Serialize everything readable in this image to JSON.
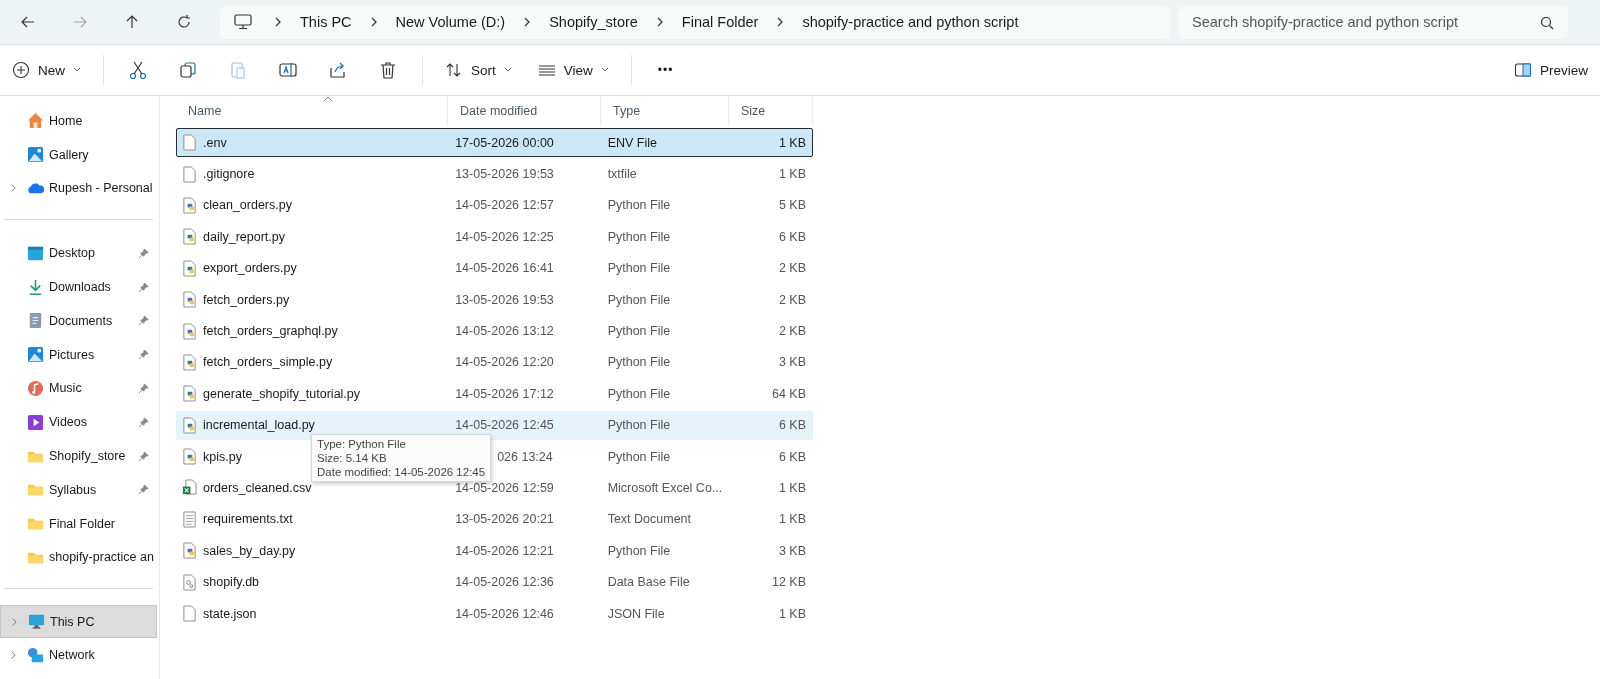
{
  "breadcrumb": [
    "This PC",
    "New Volume (D:)",
    "Shopify_store",
    "Final Folder",
    "shopify-practice and python script"
  ],
  "search": {
    "placeholder": "Search shopify-practice and python script"
  },
  "toolbar": {
    "new": "New",
    "sort": "Sort",
    "view": "View",
    "more": "•••",
    "preview": "Preview"
  },
  "sidebar": {
    "top": [
      {
        "label": "Home",
        "expandable": false
      },
      {
        "label": "Gallery",
        "expandable": false
      },
      {
        "label": "Rupesh - Personal",
        "expandable": true
      }
    ],
    "quick": [
      {
        "label": "Desktop",
        "pinned": true
      },
      {
        "label": "Downloads",
        "pinned": true
      },
      {
        "label": "Documents",
        "pinned": true
      },
      {
        "label": "Pictures",
        "pinned": true
      },
      {
        "label": "Music",
        "pinned": true
      },
      {
        "label": "Videos",
        "pinned": true
      },
      {
        "label": "Shopify_store",
        "pinned": true
      },
      {
        "label": "Syllabus",
        "pinned": true
      },
      {
        "label": "Final Folder",
        "pinned": false
      },
      {
        "label": "shopify-practice an",
        "pinned": false
      }
    ],
    "bottom": [
      {
        "label": "This PC",
        "selected": true
      },
      {
        "label": "Network",
        "selected": false
      }
    ]
  },
  "columns": [
    "Name",
    "Date modified",
    "Type",
    "Size"
  ],
  "files": [
    {
      "name": ".env",
      "date": "17-05-2026 00:00",
      "type": "ENV File",
      "size": "1 KB",
      "kind": "blank",
      "selected": true,
      "hovered": false
    },
    {
      "name": ".gitignore",
      "date": "13-05-2026 19:53",
      "type": "txtfile",
      "size": "1 KB",
      "kind": "blank",
      "selected": false,
      "hovered": false
    },
    {
      "name": "clean_orders.py",
      "date": "14-05-2026 12:57",
      "type": "Python File",
      "size": "5 KB",
      "kind": "python",
      "selected": false,
      "hovered": false
    },
    {
      "name": "daily_report.py",
      "date": "14-05-2026 12:25",
      "type": "Python File",
      "size": "6 KB",
      "kind": "python",
      "selected": false,
      "hovered": false
    },
    {
      "name": "export_orders.py",
      "date": "14-05-2026 16:41",
      "type": "Python File",
      "size": "2 KB",
      "kind": "python",
      "selected": false,
      "hovered": false
    },
    {
      "name": "fetch_orders.py",
      "date": "13-05-2026 19:53",
      "type": "Python File",
      "size": "2 KB",
      "kind": "python",
      "selected": false,
      "hovered": false
    },
    {
      "name": "fetch_orders_graphql.py",
      "date": "14-05-2026 13:12",
      "type": "Python File",
      "size": "2 KB",
      "kind": "python",
      "selected": false,
      "hovered": false
    },
    {
      "name": "fetch_orders_simple.py",
      "date": "14-05-2026 12:20",
      "type": "Python File",
      "size": "3 KB",
      "kind": "python",
      "selected": false,
      "hovered": false
    },
    {
      "name": "generate_shopify_tutorial.py",
      "date": "14-05-2026 17:12",
      "type": "Python File",
      "size": "64 KB",
      "kind": "python",
      "selected": false,
      "hovered": false
    },
    {
      "name": "incremental_load.py",
      "date": "14-05-2026 12:45",
      "type": "Python File",
      "size": "6 KB",
      "kind": "python",
      "selected": false,
      "hovered": true
    },
    {
      "name": "kpis.py",
      "date": "026 13:24",
      "type": "Python File",
      "size": "6 KB",
      "kind": "python",
      "selected": false,
      "hovered": false
    },
    {
      "name": "orders_cleaned.csv",
      "date": "14-05-2026 12:59",
      "type": "Microsoft Excel Co...",
      "size": "1 KB",
      "kind": "excel",
      "selected": false,
      "hovered": false
    },
    {
      "name": "requirements.txt",
      "date": "13-05-2026 20:21",
      "type": "Text Document",
      "size": "1 KB",
      "kind": "text",
      "selected": false,
      "hovered": false
    },
    {
      "name": "sales_by_day.py",
      "date": "14-05-2026 12:21",
      "type": "Python File",
      "size": "3 KB",
      "kind": "python",
      "selected": false,
      "hovered": false
    },
    {
      "name": "shopify.db",
      "date": "14-05-2026 12:36",
      "type": "Data Base File",
      "size": "12 KB",
      "kind": "db",
      "selected": false,
      "hovered": false
    },
    {
      "name": "state.json",
      "date": "14-05-2026 12:46",
      "type": "JSON File",
      "size": "1 KB",
      "kind": "blank",
      "selected": false,
      "hovered": false
    }
  ],
  "tooltip": [
    "Type: Python File",
    "Size: 5.14 KB",
    "Date modified: 14-05-2026 12:45"
  ]
}
